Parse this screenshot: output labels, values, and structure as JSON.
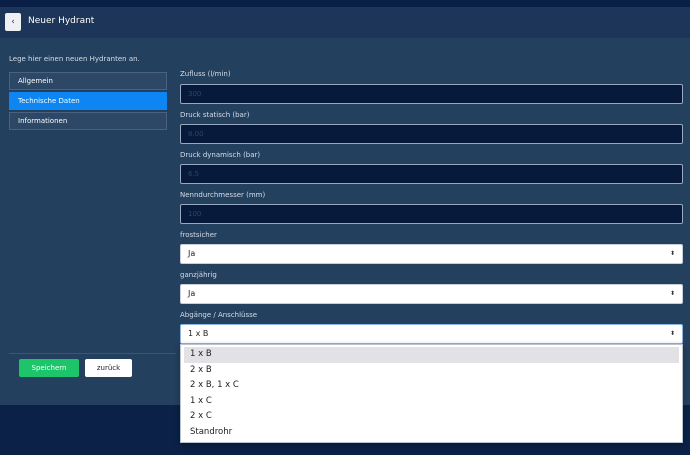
{
  "header": {
    "back_label": "‹",
    "title": "Neuer Hydrant"
  },
  "intro_text": "Lege hier einen neuen Hydranten an.",
  "sidebar": {
    "items": [
      {
        "label": "Allgemein"
      },
      {
        "label": "Technische Daten"
      },
      {
        "label": "Informationen"
      }
    ]
  },
  "form": {
    "zufluss": {
      "label": "Zufluss (l/min)",
      "placeholder": "300"
    },
    "druck_statisch": {
      "label": "Druck statisch (bar)",
      "placeholder": "8.00"
    },
    "druck_dynamisch": {
      "label": "Druck dynamisch (bar)",
      "placeholder": "6.5"
    },
    "nenndurchmesser": {
      "label": "Nenndurchmesser (mm)",
      "placeholder": "100"
    },
    "frostsicher": {
      "label": "frostsicher",
      "value": "Ja"
    },
    "ganzjaehrig": {
      "label": "ganzjährig",
      "value": "Ja"
    },
    "abgaenge": {
      "label": "Abgänge / Anschlüsse",
      "value": "1 x B",
      "options": [
        "1 x B",
        "2 x B",
        "2 x B, 1 x C",
        "1 x C",
        "2 x C",
        "Standrohr"
      ]
    }
  },
  "actions": {
    "save_label": "Speichern",
    "back_label": "zurück"
  }
}
